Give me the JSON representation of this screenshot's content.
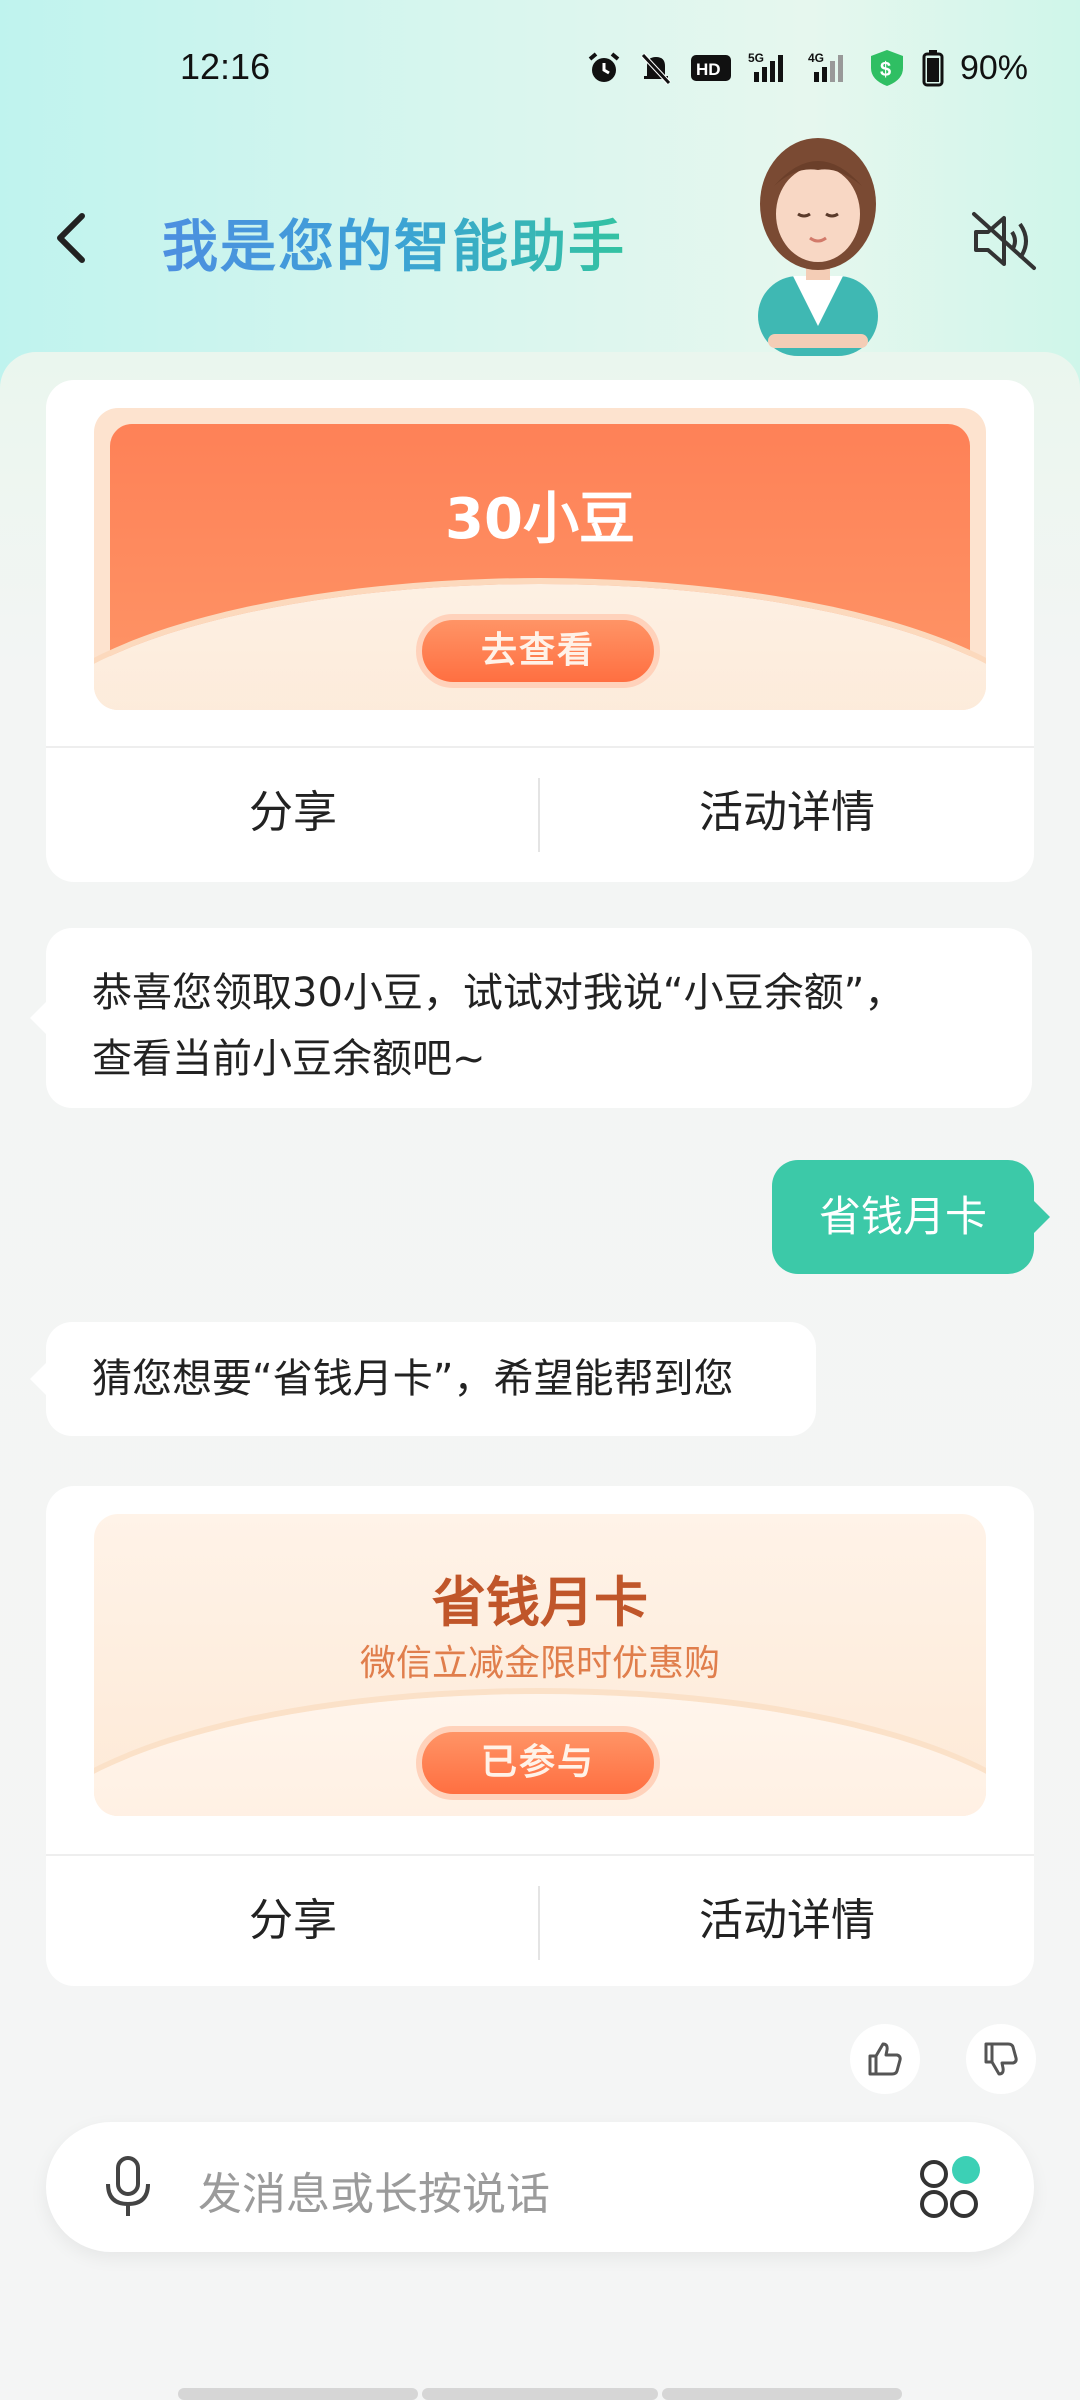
{
  "status_bar": {
    "time": "12:16",
    "battery": "90%",
    "net1": "5G",
    "net2": "4G",
    "hd": "HD"
  },
  "header": {
    "title": "我是您的智能助手"
  },
  "cards": [
    {
      "promo_title": "30小豆",
      "promo_button": "去查看",
      "share": "分享",
      "details": "活动详情"
    },
    {
      "promo_title": "省钱月卡",
      "promo_subtitle": "微信立减金限时优惠购",
      "promo_button": "已参与",
      "share": "分享",
      "details": "活动详情"
    }
  ],
  "messages": {
    "bot1_line1": "恭喜您领取30小豆，试试对我说“小豆余额”，",
    "bot1_line2": "查看当前小豆余额吧~",
    "user1": "省钱月卡",
    "bot2": "猜您想要“省钱月卡”，希望能帮到您"
  },
  "input": {
    "placeholder": "发消息或长按说话"
  },
  "colors": {
    "accent": "#3cc9a8",
    "promo_orange": "#fe8157",
    "promo_text": "#c0562a"
  }
}
